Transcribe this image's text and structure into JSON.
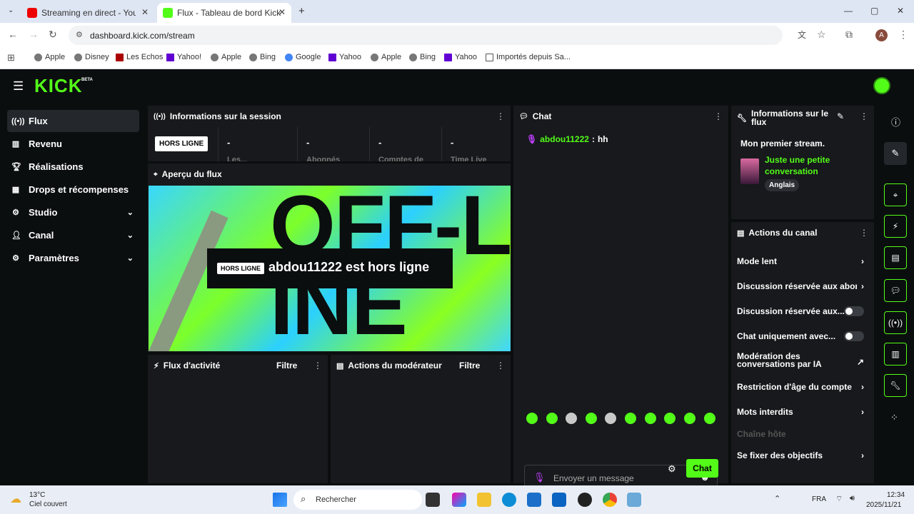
{
  "browser": {
    "tabs": [
      {
        "title": "Streaming en direct - YouTube",
        "active": false
      },
      {
        "title": "Flux - Tableau de bord Kick",
        "active": true
      }
    ],
    "url": "dashboard.kick.com/stream",
    "profile_initial": "A",
    "bookmarks": [
      "Apple",
      "Disney",
      "Les Echos",
      "Yahoo!",
      "Apple",
      "Bing",
      "Google",
      "Yahoo",
      "Apple",
      "Bing",
      "Yahoo",
      "Importés depuis Sa..."
    ]
  },
  "app": {
    "logo": "KICK",
    "logo_badge": "BETA",
    "accent": "#53fc18",
    "nav": [
      {
        "label": "Flux",
        "icon": "broadcast-icon",
        "active": true,
        "expandable": false
      },
      {
        "label": "Revenu",
        "icon": "chart-icon",
        "active": false,
        "expandable": false
      },
      {
        "label": "Réalisations",
        "icon": "trophy-icon",
        "active": false,
        "expandable": false
      },
      {
        "label": "Drops et récompenses",
        "icon": "grid-icon",
        "active": false,
        "expandable": false
      },
      {
        "label": "Studio",
        "icon": "gear-icon",
        "active": false,
        "expandable": true
      },
      {
        "label": "Canal",
        "icon": "user-icon",
        "active": false,
        "expandable": true
      },
      {
        "label": "Paramètres",
        "icon": "settings-icon",
        "active": false,
        "expandable": true
      }
    ],
    "session": {
      "title": "Informations sur la session",
      "status_badge": "HORS LIGNE",
      "stats": [
        {
          "value": "-",
          "label": "Les..."
        },
        {
          "value": "-",
          "label": "Abonnés"
        },
        {
          "value": "-",
          "label": "Comptes de"
        },
        {
          "value": "-",
          "label": "Time Live"
        }
      ]
    },
    "preview": {
      "title": "Aperçu du flux",
      "badge": "HORS LIGNE",
      "message": "abdou11222 est hors ligne",
      "bg_text": "OFF-LINE"
    },
    "activity": {
      "title": "Flux d'activité",
      "filter": "Filtre"
    },
    "moderator": {
      "title": "Actions du modérateur",
      "filter": "Filtre"
    },
    "chat": {
      "title": "Chat",
      "messages": [
        {
          "user": "abdou11222",
          "text": "hh"
        }
      ],
      "placeholder": "Envoyer un message",
      "send_label": "Chat"
    },
    "stream_info": {
      "title": "Informations sur le flux",
      "stream_title": "Mon premier stream.",
      "category": "Juste une petite conversation",
      "language": "Anglais"
    },
    "channel_actions": {
      "title": "Actions du canal",
      "items": [
        {
          "label": "Mode lent",
          "control": "chevron"
        },
        {
          "label": "Discussion réservée aux abonnés",
          "control": "chevron"
        },
        {
          "label": "Discussion réservée aux...",
          "control": "toggle"
        },
        {
          "label": "Chat uniquement avec...",
          "control": "toggle"
        },
        {
          "label": "Modération des conversations par IA",
          "control": "external"
        },
        {
          "label": "Restriction d'âge du compte",
          "control": "chevron"
        },
        {
          "label": "Mots interdits",
          "control": "chevron"
        },
        {
          "label": "Chaîne hôte",
          "control": "none"
        },
        {
          "label": "Se fixer des objectifs",
          "control": "chevron"
        }
      ]
    }
  },
  "taskbar": {
    "weather_temp": "13°C",
    "weather_desc": "Ciel couvert",
    "search_placeholder": "Rechercher",
    "language": "FRA",
    "time": "12:34",
    "date": "2025/11/21"
  }
}
